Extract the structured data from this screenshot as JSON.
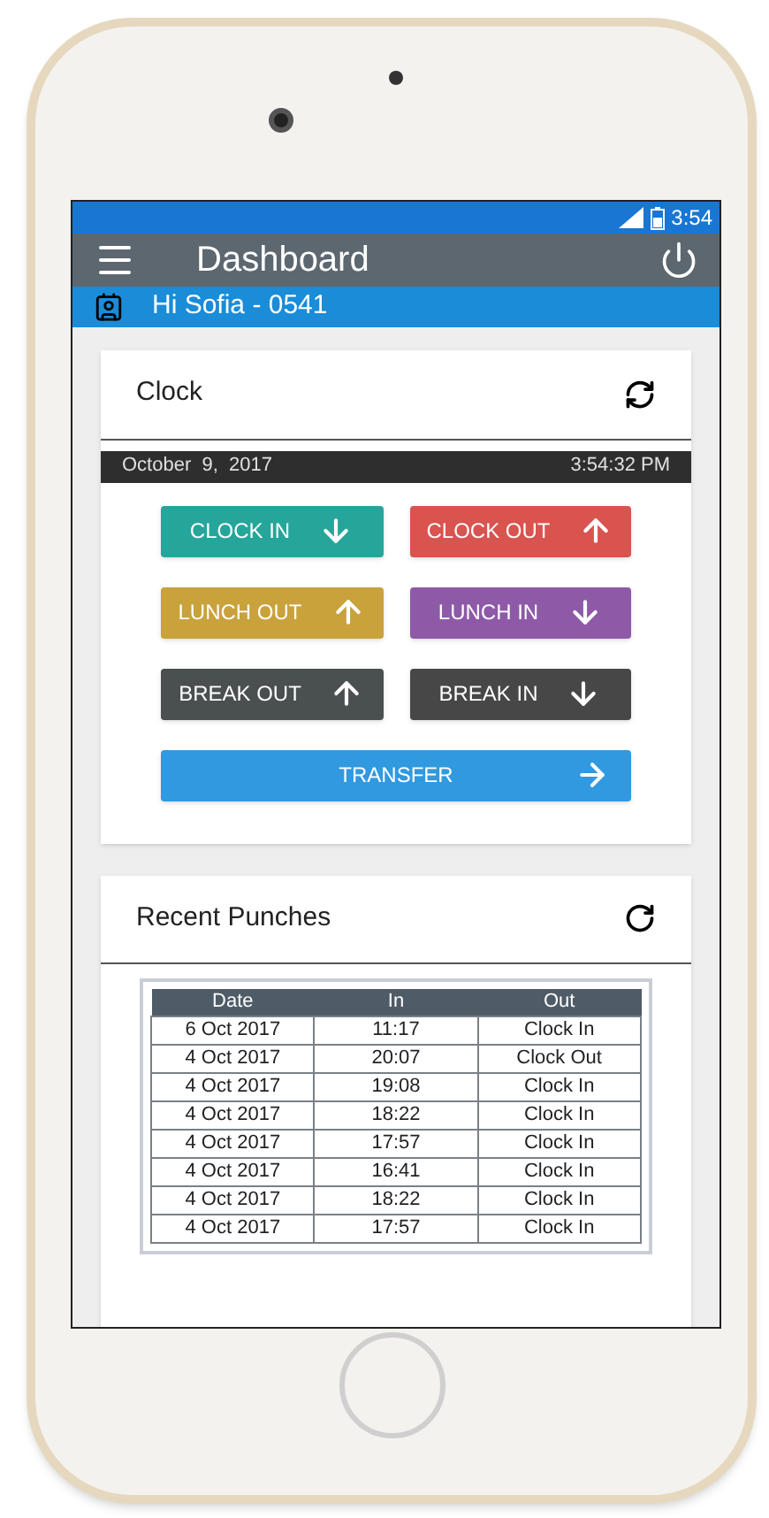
{
  "status_bar": {
    "time": "3:54"
  },
  "app_bar": {
    "title": "Dashboard"
  },
  "greeting": "Hi Sofia - 0541",
  "clock": {
    "title": "Clock",
    "date": "October  9,  2017",
    "time": "3:54:32 PM",
    "buttons": [
      {
        "label": "CLOCK IN",
        "color": "#26a69a",
        "kind": "down"
      },
      {
        "label": "CLOCK OUT",
        "color": "#d9534f",
        "kind": "up"
      },
      {
        "label": "LUNCH OUT",
        "color": "#c9a23c",
        "kind": "up"
      },
      {
        "label": "LUNCH IN",
        "color": "#8e5aa8",
        "kind": "down"
      },
      {
        "label": "BREAK OUT",
        "color": "#4a4f4f",
        "kind": "up"
      },
      {
        "label": "BREAK IN",
        "color": "#474747",
        "kind": "down"
      }
    ],
    "transfer": {
      "label": "TRANSFER",
      "color": "#3199e0",
      "kind": "right"
    }
  },
  "recent_punches": {
    "title": "Recent Punches",
    "columns": [
      "Date",
      "In",
      "Out"
    ],
    "rows": [
      [
        "6 Oct 2017",
        "11:17",
        "Clock In"
      ],
      [
        "4 Oct 2017",
        "20:07",
        "Clock Out"
      ],
      [
        "4 Oct 2017",
        "19:08",
        "Clock In"
      ],
      [
        "4 Oct 2017",
        "18:22",
        "Clock In"
      ],
      [
        "4 Oct 2017",
        "17:57",
        "Clock In"
      ],
      [
        "4 Oct 2017",
        "16:41",
        "Clock In"
      ],
      [
        "4 Oct 2017",
        "18:22",
        "Clock In"
      ],
      [
        "4 Oct 2017",
        "17:57",
        "Clock In"
      ]
    ]
  }
}
